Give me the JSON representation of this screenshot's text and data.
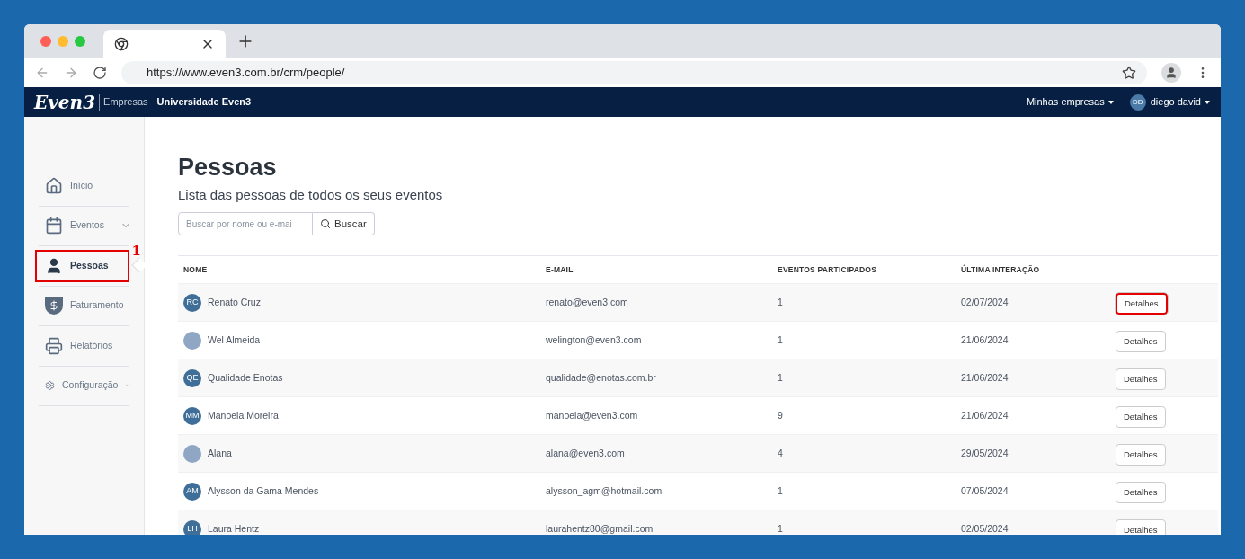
{
  "browser": {
    "url": "https://www.even3.com.br/crm/people/"
  },
  "navbar": {
    "logo": "Even3",
    "brand_suffix": "Empresas",
    "links": [
      "Universidade Even3"
    ],
    "companies_menu": "Minhas empresas",
    "user": {
      "initials": "DD",
      "name": "diego david"
    }
  },
  "sidebar": {
    "items": [
      {
        "kind": "home",
        "label": "Início",
        "selected": false,
        "expandable": false,
        "highlighted": false
      },
      {
        "kind": "calendar",
        "label": "Eventos",
        "selected": false,
        "expandable": true,
        "highlighted": false
      },
      {
        "kind": "person",
        "label": "Pessoas",
        "selected": true,
        "expandable": false,
        "highlighted": true,
        "callout": "1"
      },
      {
        "kind": "money",
        "label": "Faturamento",
        "selected": false,
        "expandable": false,
        "highlighted": false
      },
      {
        "kind": "printer",
        "label": "Relatórios",
        "selected": false,
        "expandable": false,
        "highlighted": false
      },
      {
        "kind": "gears",
        "label": "Configuração",
        "selected": false,
        "expandable": true,
        "highlighted": false
      }
    ]
  },
  "page": {
    "title": "Pessoas",
    "subtitle": "Lista das pessoas de todos os seus eventos",
    "search": {
      "placeholder": "Buscar por nome ou e-mai",
      "button": "Buscar"
    }
  },
  "table": {
    "columns": [
      "NOME",
      "E-MAIL",
      "EVENTOS PARTICIPADOS",
      "ÚLTIMA INTERAÇÃO"
    ],
    "rows": [
      {
        "avatar": {
          "kind": "initials",
          "initials": "RC"
        },
        "name": "Renato Cruz",
        "email": "renato@even3.com",
        "events": "1",
        "last": "02/07/2024",
        "action": "Detalhes",
        "highlighted": true
      },
      {
        "avatar": {
          "kind": "photo"
        },
        "name": "Wel Almeida",
        "email": "welington@even3.com",
        "events": "1",
        "last": "21/06/2024",
        "action": "Detalhes",
        "highlighted": false
      },
      {
        "avatar": {
          "kind": "initials",
          "initials": "QE"
        },
        "name": "Qualidade Enotas",
        "email": "qualidade@enotas.com.br",
        "events": "1",
        "last": "21/06/2024",
        "action": "Detalhes",
        "highlighted": false
      },
      {
        "avatar": {
          "kind": "initials",
          "initials": "MM"
        },
        "name": "Manoela Moreira",
        "email": "manoela@even3.com",
        "events": "9",
        "last": "21/06/2024",
        "action": "Detalhes",
        "highlighted": false
      },
      {
        "avatar": {
          "kind": "photo"
        },
        "name": "Alana",
        "email": "alana@even3.com",
        "events": "4",
        "last": "29/05/2024",
        "action": "Detalhes",
        "highlighted": false
      },
      {
        "avatar": {
          "kind": "initials",
          "initials": "AM"
        },
        "name": "Alysson da Gama Mendes",
        "email": "alysson_agm@hotmail.com",
        "events": "1",
        "last": "07/05/2024",
        "action": "Detalhes",
        "highlighted": false
      },
      {
        "avatar": {
          "kind": "initials",
          "initials": "LH"
        },
        "name": "Laura Hentz",
        "email": "laurahentz80@gmail.com",
        "events": "1",
        "last": "02/05/2024",
        "action": "Detalhes",
        "highlighted": false
      }
    ]
  }
}
